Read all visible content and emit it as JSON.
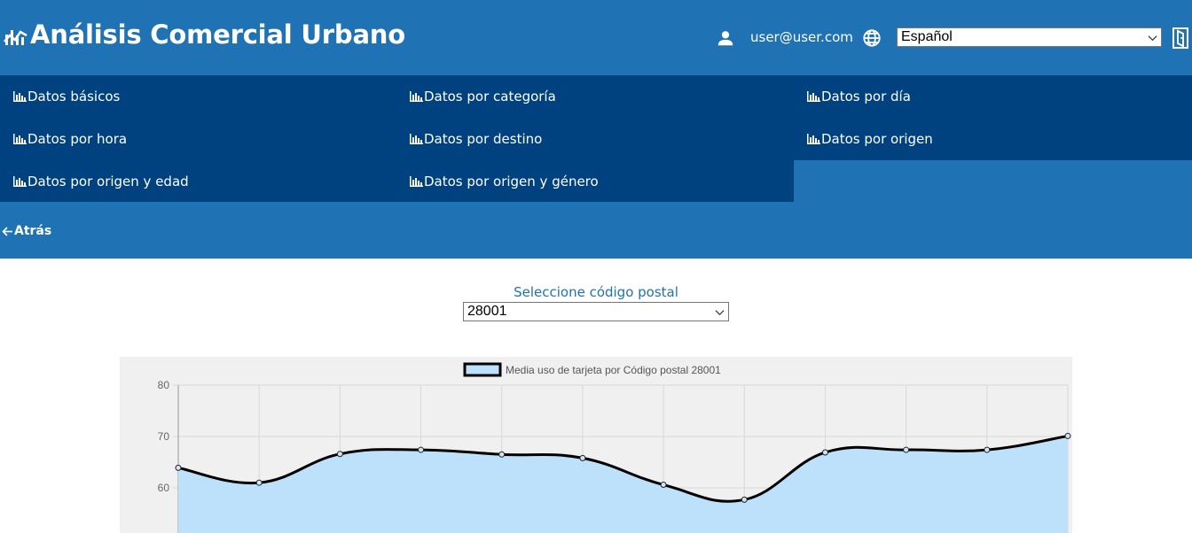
{
  "header": {
    "title": "Análisis Comercial Urbano",
    "logo_icon": "chart-trend-icon",
    "user_email": "user@user.com",
    "language_selected": "Español",
    "background_color": "#1f72b3"
  },
  "nav": {
    "background_color": "#004280",
    "items": [
      {
        "label": "Datos básicos",
        "icon": "bar-chart-icon"
      },
      {
        "label": "Datos por categoría",
        "icon": "bar-chart-icon"
      },
      {
        "label": "Datos por día",
        "icon": "bar-chart-icon"
      },
      {
        "label": "Datos por hora",
        "icon": "bar-chart-icon"
      },
      {
        "label": "Datos por destino",
        "icon": "bar-chart-icon"
      },
      {
        "label": "Datos por origen",
        "icon": "bar-chart-icon"
      },
      {
        "label": "Datos por origen y edad",
        "icon": "bar-chart-icon"
      },
      {
        "label": "Datos por origen y género",
        "icon": "bar-chart-icon"
      }
    ]
  },
  "back": {
    "label": "Atrás"
  },
  "postal": {
    "label": "Seleccione código postal",
    "selected": "28001"
  },
  "chart_data": {
    "type": "area",
    "series": [
      {
        "name": "Media uso de tarjeta por Código postal 28001",
        "values": [
          63.9,
          61.0,
          66.6,
          67.4,
          66.5,
          65.8,
          60.6,
          57.7,
          66.9,
          67.4,
          67.4,
          70.1
        ],
        "fill_color": "#bde0fb",
        "line_color": "#000000"
      }
    ],
    "y_ticks": [
      60,
      70,
      80
    ],
    "ylim": [
      50,
      80
    ],
    "grid": true,
    "legend_position": "top-center"
  }
}
